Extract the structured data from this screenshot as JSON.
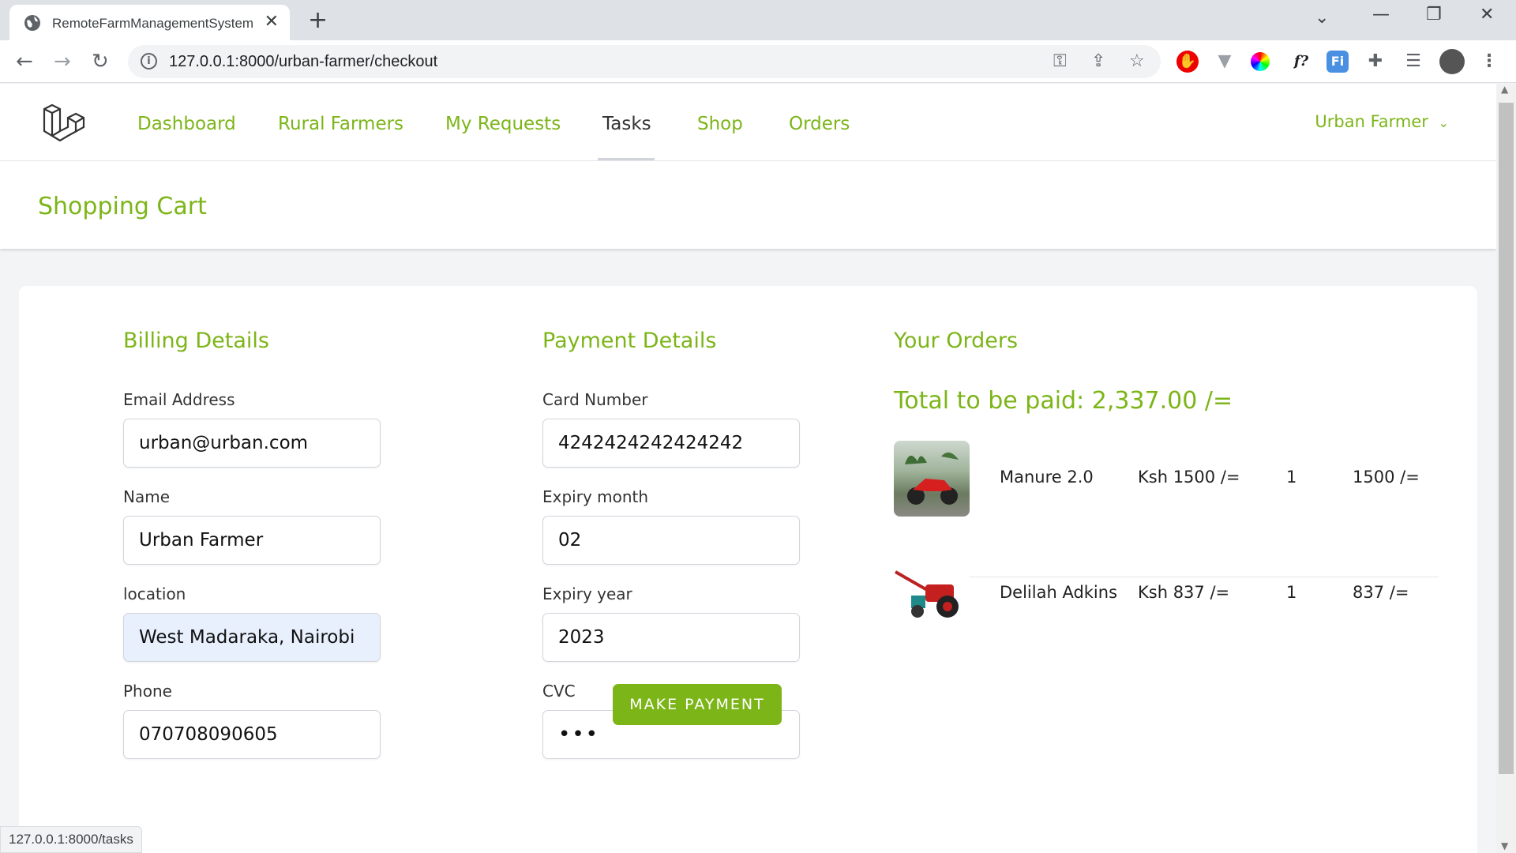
{
  "browser": {
    "tab_title": "RemoteFarmManagementSystem",
    "url": "127.0.0.1:8000/urban-farmer/checkout",
    "status_url": "127.0.0.1:8000/tasks"
  },
  "nav": {
    "links": [
      "Dashboard",
      "Rural Farmers",
      "My Requests",
      "Tasks",
      "Shop",
      "Orders"
    ],
    "active": "Tasks",
    "user": "Urban Farmer"
  },
  "header": {
    "title": "Shopping Cart"
  },
  "billing": {
    "title": "Billing Details",
    "email_label": "Email Address",
    "email": "urban@urban.com",
    "name_label": "Name",
    "name": "Urban Farmer",
    "location_label": "location",
    "location": "West Madaraka, Nairobi",
    "phone_label": "Phone",
    "phone": "070708090605"
  },
  "payment": {
    "title": "Payment Details",
    "card_label": "Card Number",
    "card": "4242424242424242",
    "month_label": "Expiry month",
    "month": "02",
    "year_label": "Expiry year",
    "year": "2023",
    "cvc_label": "CVC",
    "cvc": "•••",
    "button": "MAKE PAYMENT"
  },
  "orders": {
    "title": "Your Orders",
    "total": "Total to be paid: 2,337.00 /=",
    "items": [
      {
        "name": "Manure 2.0",
        "price": "Ksh 1500 /=",
        "qty": "1",
        "subtotal": "1500 /="
      },
      {
        "name": "Delilah Adkins",
        "price": "Ksh 837 /=",
        "qty": "1",
        "subtotal": "837 /="
      }
    ]
  },
  "colors": {
    "accent": "#7cb518"
  }
}
